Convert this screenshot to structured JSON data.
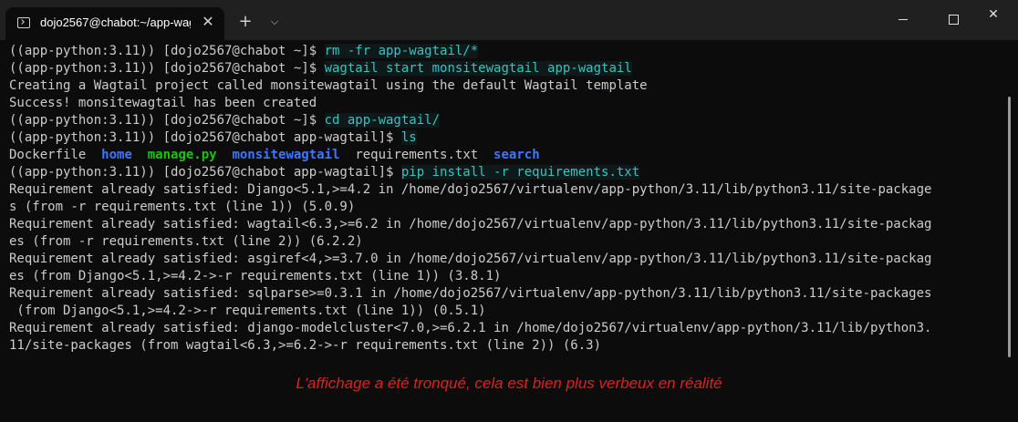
{
  "window": {
    "tab_title": "dojo2567@chabot:~/app-wag",
    "close_tab_glyph": "✕",
    "new_tab_glyph": "+",
    "dropdown_glyph": "⌵",
    "close_glyph": "✕"
  },
  "terminal": {
    "lines": [
      {
        "prompt": "((app-python:3.11)) [dojo2567@chabot ~]$ ",
        "cmd": "rm -fr app-wagtail/*"
      },
      {
        "prompt": "((app-python:3.11)) [dojo2567@chabot ~]$ ",
        "cmd": "wagtail start monsitewagtail app-wagtail"
      },
      {
        "text": "Creating a Wagtail project called monsitewagtail using the default Wagtail template"
      },
      {
        "text": "Success! monsitewagtail has been created"
      },
      {
        "prompt": "((app-python:3.11)) [dojo2567@chabot ~]$ ",
        "cmd": "cd app-wagtail/"
      },
      {
        "prompt": "((app-python:3.11)) [dojo2567@chabot app-wagtail]$ ",
        "cmd": "ls"
      },
      {
        "ls": {
          "dockerfile": "Dockerfile",
          "home": "home",
          "manage": "manage.py",
          "monsite": "monsitewagtail",
          "requirements": "requirements.txt",
          "search": "search"
        }
      },
      {
        "prompt": "((app-python:3.11)) [dojo2567@chabot app-wagtail]$ ",
        "cmd": "pip install -r requirements.txt"
      },
      {
        "text": "Requirement already satisfied: Django<5.1,>=4.2 in /home/dojo2567/virtualenv/app-python/3.11/lib/python3.11/site-package"
      },
      {
        "text": "s (from -r requirements.txt (line 1)) (5.0.9)"
      },
      {
        "text": "Requirement already satisfied: wagtail<6.3,>=6.2 in /home/dojo2567/virtualenv/app-python/3.11/lib/python3.11/site-packag"
      },
      {
        "text": "es (from -r requirements.txt (line 2)) (6.2.2)"
      },
      {
        "text": "Requirement already satisfied: asgiref<4,>=3.7.0 in /home/dojo2567/virtualenv/app-python/3.11/lib/python3.11/site-packag"
      },
      {
        "text": "es (from Django<5.1,>=4.2->-r requirements.txt (line 1)) (3.8.1)"
      },
      {
        "text": "Requirement already satisfied: sqlparse>=0.3.1 in /home/dojo2567/virtualenv/app-python/3.11/lib/python3.11/site-packages"
      },
      {
        "text": " (from Django<5.1,>=4.2->-r requirements.txt (line 1)) (0.5.1)"
      },
      {
        "text": "Requirement already satisfied: django-modelcluster<7.0,>=6.2.1 in /home/dojo2567/virtualenv/app-python/3.11/lib/python3."
      },
      {
        "text": "11/site-packages (from wagtail<6.3,>=6.2->-r requirements.txt (line 2)) (6.3)"
      }
    ]
  },
  "note": "L'affichage a été tronqué, cela est bien plus verbeux en réalité",
  "colors": {
    "background": "#0c0c0c",
    "titlebar": "#202020",
    "text": "#cccccc",
    "command": "#3ac1c1",
    "directory": "#3b78ff",
    "executable": "#16c60c",
    "note": "#e02020"
  }
}
